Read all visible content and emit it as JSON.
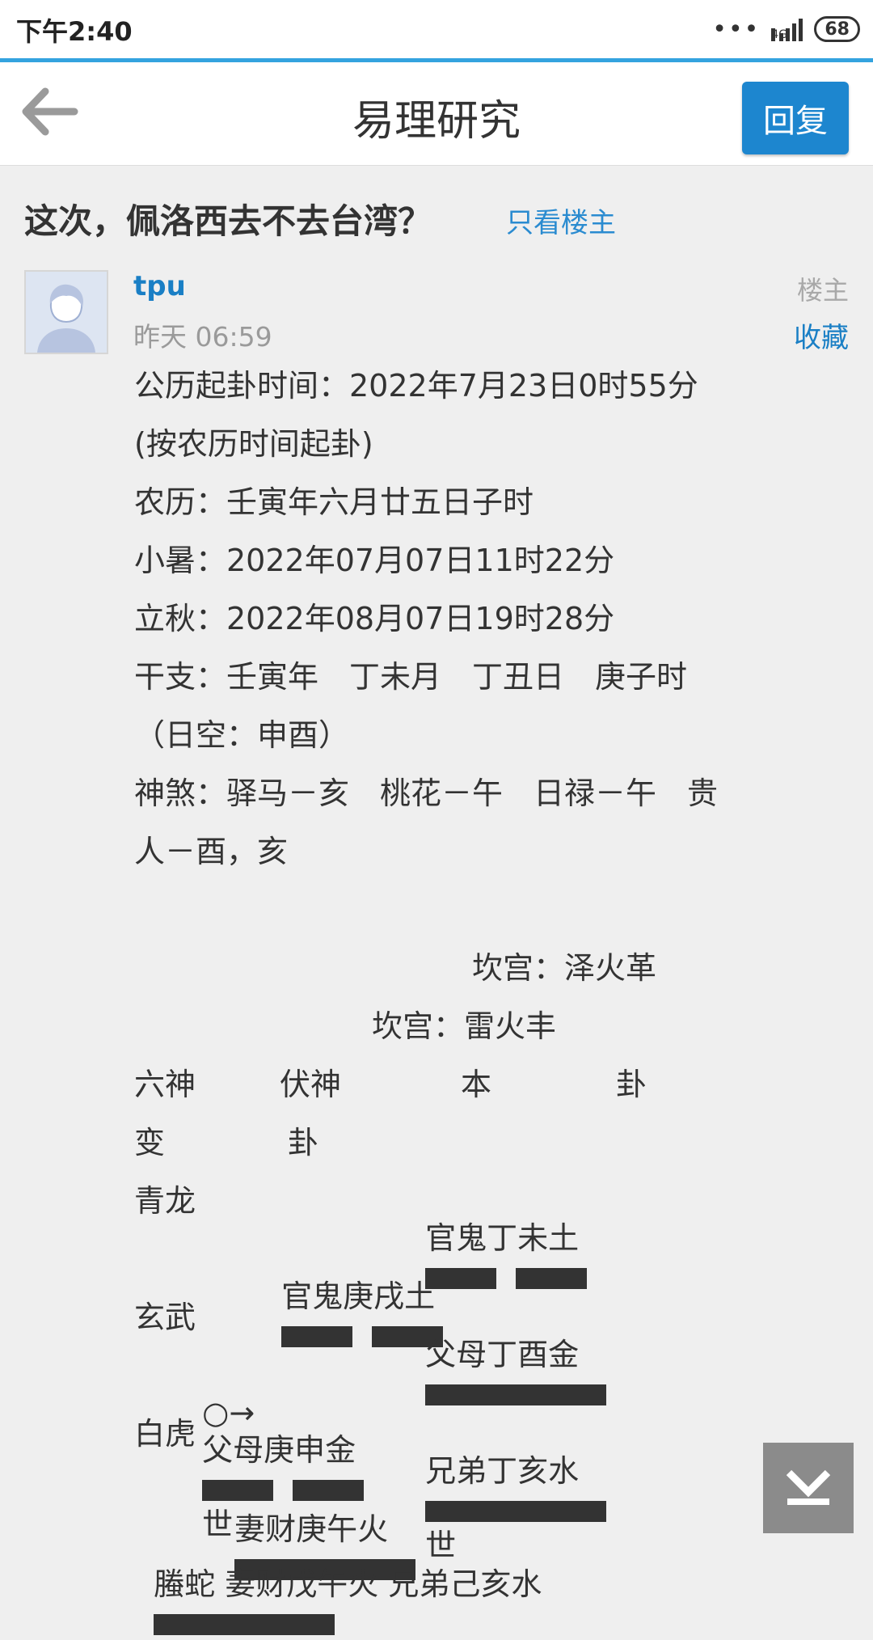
{
  "status_bar": {
    "time": "下午2:40",
    "dots": "•••",
    "network": "4G",
    "battery": "68"
  },
  "header": {
    "title": "易理研究",
    "reply_label": "回复"
  },
  "thread": {
    "title": "这次，佩洛西去不去台湾？",
    "only_op_label": "只看楼主"
  },
  "post": {
    "username": "tpu",
    "time": "昨天 06:59",
    "op_tag": "楼主",
    "favorite_label": "收藏",
    "lines": {
      "l1": "公历起卦时间：2022年7月23日0时55分",
      "l2": "(按农历时间起卦)",
      "l3": "农历：壬寅年六月廿五日子时",
      "l4": "小暑：2022年07月07日11时22分",
      "l5": "立秋：2022年08月07日19时28分",
      "l6": "干支：壬寅年　丁未月　丁丑日　庚子时",
      "l7": "（日空：申酉）",
      "l8": "神煞：驿马－亥　桃花－午　日禄－午　贵",
      "l9": "人－酉，亥",
      "l10": "坎宫：泽火革",
      "l11": "坎宫：雷火丰",
      "h1": "六神",
      "h2": "伏神",
      "h3": "本",
      "h4": "卦",
      "h5": "变",
      "h6": "卦",
      "r1_god": "青龙",
      "r1_text": "官鬼丁未土",
      "r2_text": "官鬼庚戌土",
      "r3_god": "玄武",
      "r3_text": "父母丁酉金",
      "r4_mark": "○→",
      "r4_text": "父母庚申金",
      "r4_shi": "世",
      "r5_god": "白虎",
      "r5_text": "兄弟丁亥水",
      "r5_shi": "世",
      "r6_text": "妻财庚午火",
      "r7_text": "螣蛇 妻财戊午火 兄弟己亥水"
    }
  }
}
